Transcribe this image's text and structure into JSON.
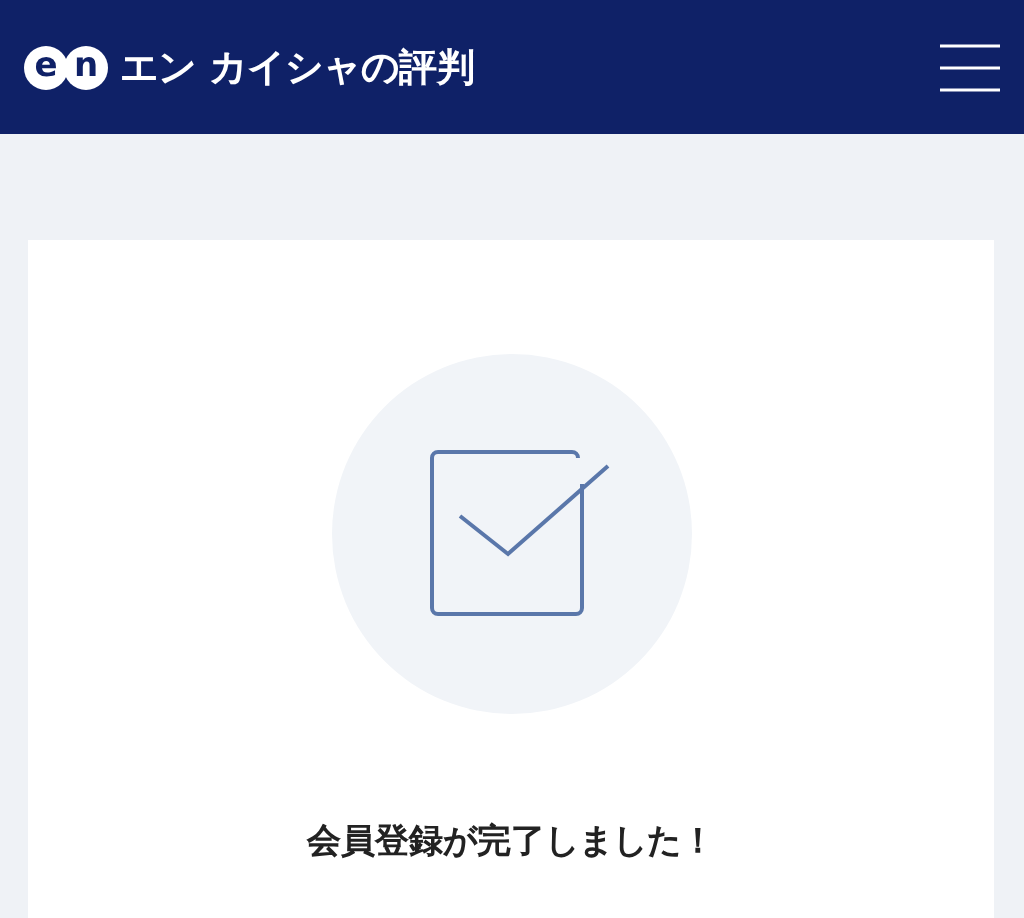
{
  "header": {
    "logo_letters": [
      "e",
      "n"
    ],
    "title": "エン カイシャの評判"
  },
  "card": {
    "message": "会員登録が完了しました！"
  }
}
